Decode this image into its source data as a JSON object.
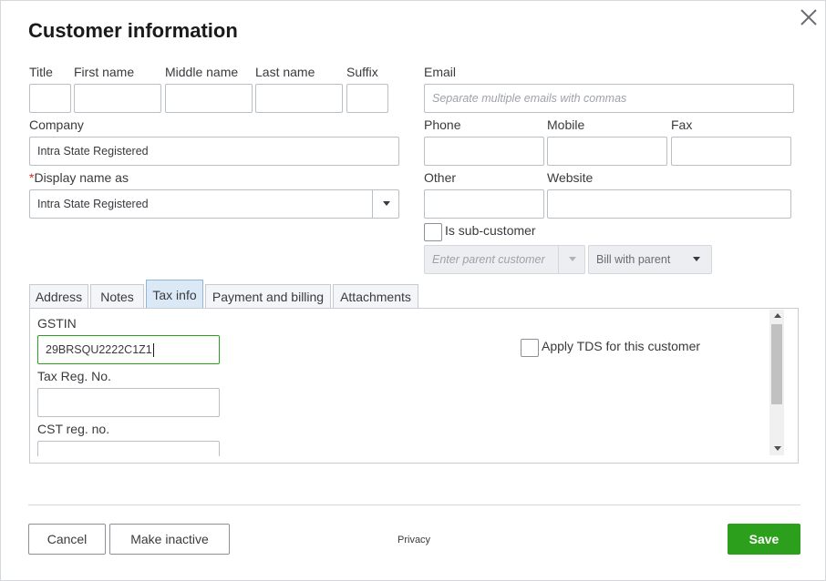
{
  "dialog": {
    "title": "Customer information"
  },
  "name_fields": {
    "title_label": "Title",
    "first_label": "First name",
    "middle_label": "Middle name",
    "last_label": "Last name",
    "suffix_label": "Suffix"
  },
  "email": {
    "label": "Email",
    "placeholder": "Separate multiple emails with commas"
  },
  "company": {
    "label": "Company",
    "value": "Intra State Registered"
  },
  "phone": {
    "label": "Phone"
  },
  "mobile": {
    "label": "Mobile"
  },
  "fax": {
    "label": "Fax"
  },
  "display_name": {
    "required_mark": "*",
    "label": "Display name as",
    "value": "Intra State Registered"
  },
  "other": {
    "label": "Other"
  },
  "website": {
    "label": "Website"
  },
  "sub_customer": {
    "label": "Is sub-customer",
    "parent_placeholder": "Enter parent customer",
    "bill_option": "Bill with parent"
  },
  "tabs": [
    {
      "label": "Address"
    },
    {
      "label": "Notes"
    },
    {
      "label": "Tax info"
    },
    {
      "label": "Payment and billing"
    },
    {
      "label": "Attachments"
    }
  ],
  "tax_info": {
    "gstin_label": "GSTIN",
    "gstin_value": "29BRSQU2222C1Z1",
    "tax_reg_label": "Tax Reg. No.",
    "cst_label": "CST reg. no.",
    "tds_label": "Apply TDS for this customer"
  },
  "footer": {
    "cancel": "Cancel",
    "make_inactive": "Make inactive",
    "privacy": "Privacy",
    "save": "Save"
  },
  "colors": {
    "save_green": "#2ca01c",
    "focus_green": "#2ca01c",
    "active_tab": "#dbe9f7",
    "required_red": "#d52b1e"
  },
  "icons": {
    "close": "close-icon",
    "dropdown": "chevron-down-icon"
  }
}
